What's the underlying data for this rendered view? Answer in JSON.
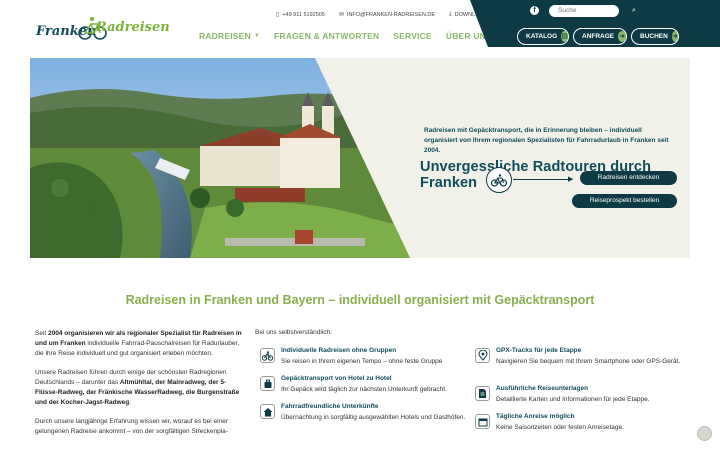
{
  "logo": {
    "part1": "Franken",
    "part2": "Radreisen"
  },
  "topbar": {
    "phone": "+49 911 5192505",
    "email": "INFO@FRANKEN-RADREISEN.DE",
    "download": "DOWNLOAD"
  },
  "nav": {
    "items": [
      "RADREISEN",
      "FRAGEN & ANTWORTEN",
      "SERVICE",
      "ÜBER UNS"
    ]
  },
  "header_panel": {
    "search_placeholder": "Suche",
    "buttons": [
      "KATALOG",
      "ANFRAGE",
      "BUCHEN"
    ]
  },
  "hero": {
    "title": "Unvergessliche Radtouren durch Franken",
    "subtitle": "Radreisen mit Gepäcktransport, die in Erinnerung bleiben – individuell organisiert von Ihrem regionalen Spezialisten für Fahrradurlaub in Franken seit 2004.",
    "btn_discover": "Radreisen entdecken",
    "btn_brochure": "Reiseprospekt bestellen"
  },
  "section": {
    "title": "Radreisen in Franken und Bayern – individuell organisiert mit Gepäcktransport"
  },
  "intro": {
    "p1_a": "Seit ",
    "p1_b": "2004 organisieren wir als regionaler Spezialist für Radreisen in und um Franken",
    "p1_c": " individuelle Fahrrad-Pauschalreisen für Radurlauber, die ihre Reise individuell und gut organisiert erleben möchten.",
    "p2_a": "Unsere Radreisen führen durch einige der schönsten Radregionen Deutschlands – darunter das ",
    "p2_b": "Altmühltal, der Mainradweg, der 5-Flüsse-Radweg, der Fränkische WasserRadweg, die Burgenstraße und der Kocher-Jagst-Radweg",
    "p2_c": ".",
    "p3": "Durch unsere langjährige Erfahrung wissen wir, worauf es bei einer gelungenen Radreise ankommt – von der sorgfältigen Streckenpla-"
  },
  "features": {
    "intro": "Bei uns selbstverständlich:",
    "items": [
      {
        "icon": "cyclist-icon",
        "title": "Individuelle Radreisen ohne Gruppen",
        "desc": "Sie reisen in Ihrem eigenen Tempo – ohne feste Gruppe"
      },
      {
        "icon": "location-pin-icon",
        "title": "GPX-Tracks für jede Etappe",
        "desc": "Navigieren Sie bequem mit Ihrem Smartphone oder GPS-Gerät."
      },
      {
        "icon": "luggage-icon",
        "title": "Gepäcktransport von Hotel zu Hotel",
        "desc": "Ihr Gepäck wird täglich zur nächsten Unterkunft gebracht."
      },
      {
        "icon": "document-icon",
        "title": "Ausführliche Reiseunterlagen",
        "desc": "Detaillierte Karten und Informationen für jede Etappe."
      },
      {
        "icon": "house-icon",
        "title": "Fahrradfreundliche Unterkünfte",
        "desc": "Übernachtung in sorgfältig ausgewählten Hotels und Gasthöfen."
      },
      {
        "icon": "calendar-icon",
        "title": "Tägliche Anreise möglich",
        "desc": "Keine Saisonzeiten oder festen Anreisetage."
      }
    ]
  }
}
